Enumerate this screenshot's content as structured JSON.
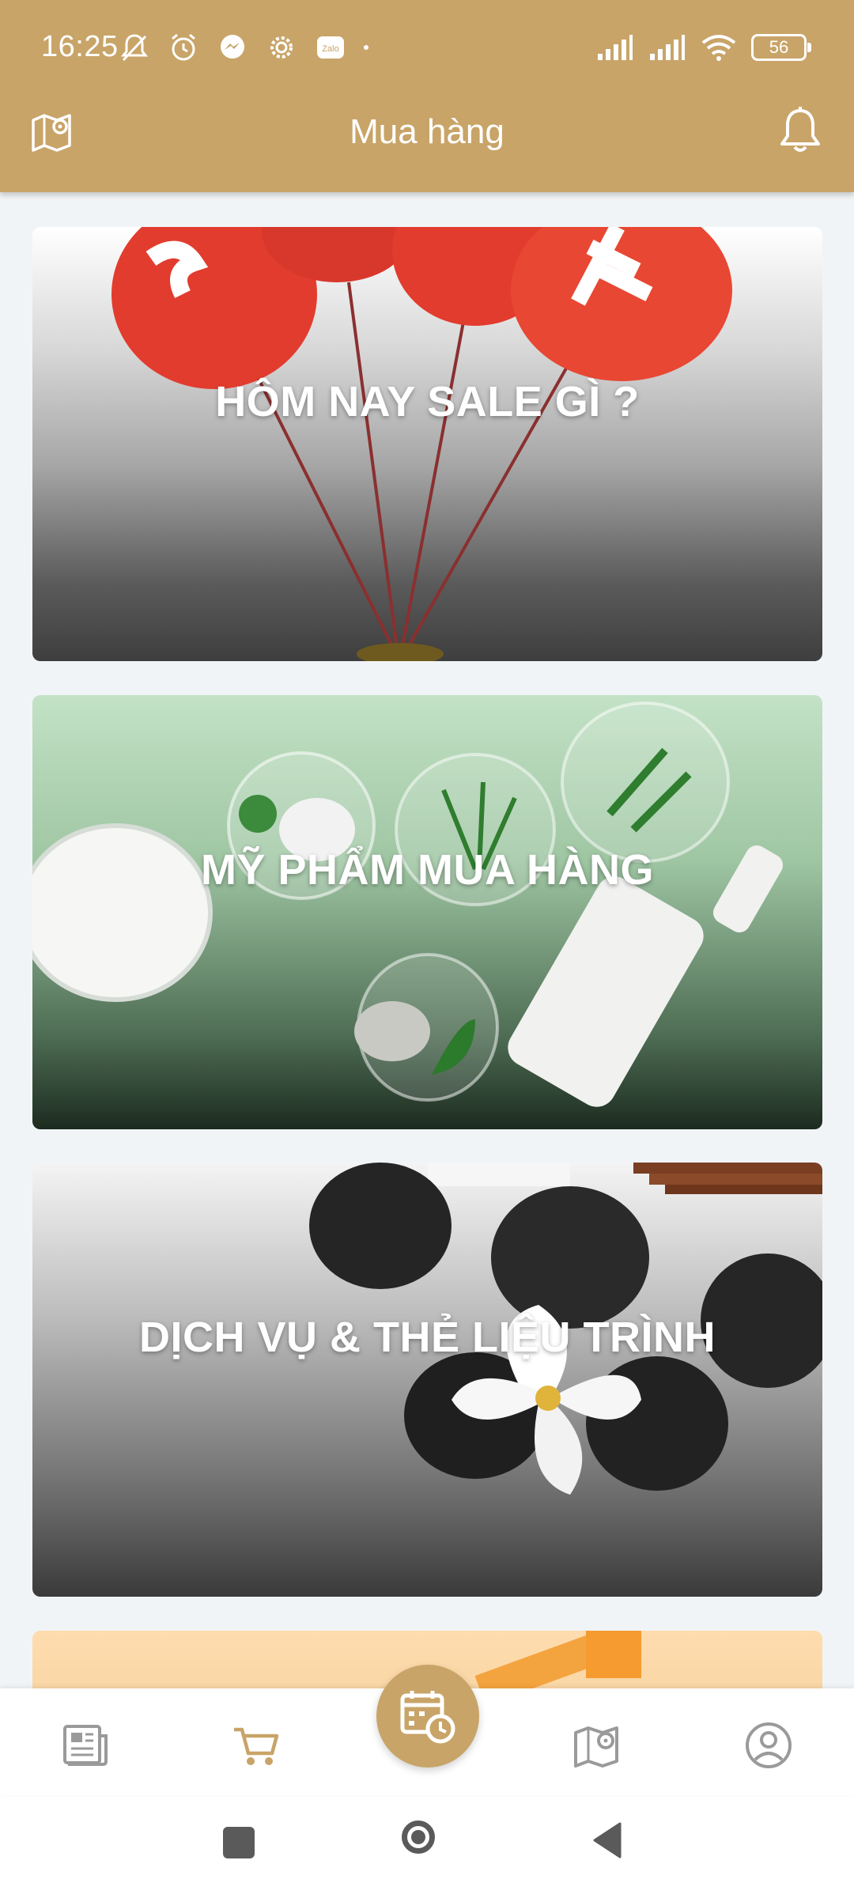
{
  "status_bar": {
    "time": "16:25",
    "battery": "56",
    "left_icons": [
      "mute-icon",
      "alarm-icon",
      "messenger-icon",
      "settings-icon",
      "zalo-icon",
      "dot-icon"
    ],
    "right_icons": [
      "signal-icon",
      "signal-icon",
      "wifi-icon",
      "battery-icon"
    ],
    "zalo_label": "Zalo"
  },
  "app_bar": {
    "title": "Mua hàng",
    "left_icon": "map-pin-icon",
    "right_icon": "bell-icon"
  },
  "cards": [
    {
      "title": "HÔM NAY SALE GÌ ?"
    },
    {
      "title": "MỸ PHẨM MUA HÀNG"
    },
    {
      "title": "DỊCH VỤ & THẺ LIỆU TRÌNH"
    }
  ],
  "bottom_nav": {
    "items": [
      "newspaper-icon",
      "cart-icon",
      "calendar-clock-icon",
      "map-pin-icon",
      "user-icon"
    ],
    "active": "cart-icon"
  },
  "colors": {
    "brand": "#c8a468",
    "nav_inactive": "#9a9a9a",
    "background": "#f1f4f6"
  }
}
